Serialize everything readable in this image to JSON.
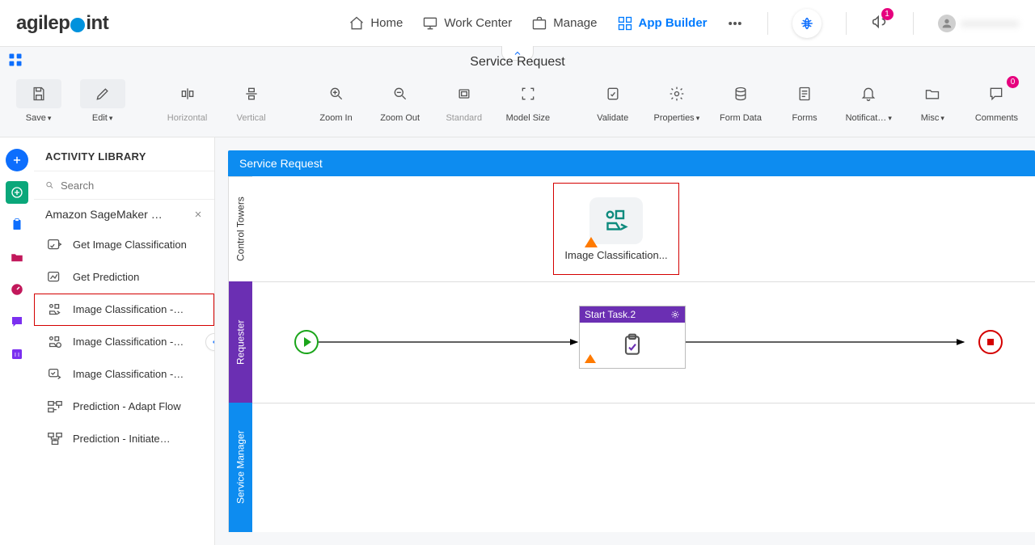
{
  "brand": {
    "pre": "agilep",
    "post": "int"
  },
  "topnav": {
    "home": "Home",
    "work_center": "Work Center",
    "manage": "Manage",
    "app_builder": "App Builder"
  },
  "badges": {
    "announce": "1",
    "comments": "0"
  },
  "username": "xxxxxxxxxxx",
  "page_title": "Service Request",
  "toolbar": {
    "save": "Save",
    "edit": "Edit",
    "horizontal": "Horizontal",
    "vertical": "Vertical",
    "zoom_in": "Zoom In",
    "zoom_out": "Zoom Out",
    "standard": "Standard",
    "model_size": "Model Size",
    "validate": "Validate",
    "properties": "Properties",
    "form_data": "Form Data",
    "forms": "Forms",
    "notifications": "Notificat…",
    "misc": "Misc",
    "comments": "Comments"
  },
  "sidebar": {
    "title": "ACTIVITY LIBRARY",
    "search_placeholder": "Search",
    "category": "Amazon SageMaker …",
    "items": [
      "Get Image Classification",
      "Get Prediction",
      "Image Classification -…",
      "Image Classification -…",
      "Image Classification -…",
      "Prediction - Adapt Flow",
      "Prediction - Initiate…"
    ]
  },
  "canvas": {
    "header": "Service Request",
    "lanes": {
      "control_towers": "Control Towers",
      "requester": "Requester",
      "service_manager": "Service Manager"
    },
    "dropped_label": "Image Classification...",
    "task_head": "Start Task.2"
  }
}
